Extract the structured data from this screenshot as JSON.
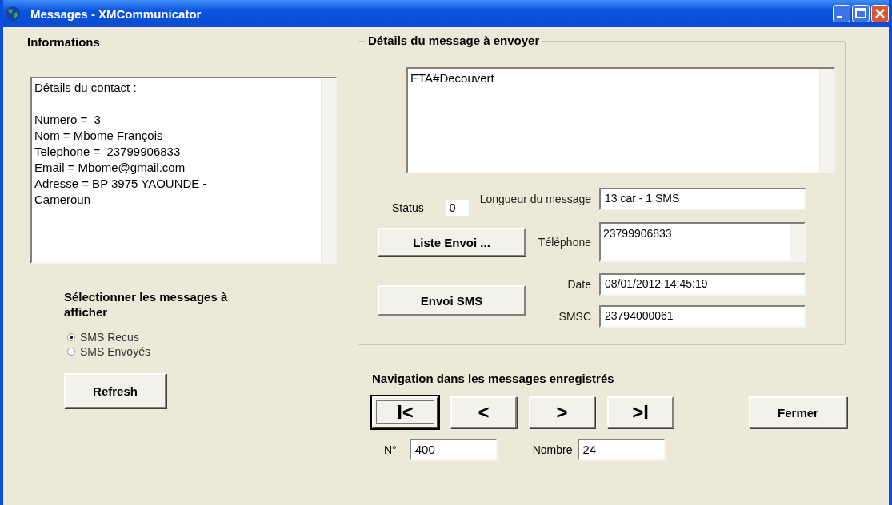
{
  "window": {
    "title": "Messages - XMCommunicator"
  },
  "informations": {
    "title": "Informations",
    "contact_heading": "Détails du contact :",
    "contact_lines": [
      "Numero =  3",
      "Nom = Mbome François",
      "Telephone =  23799906833",
      "Email = Mbome@gmail.com",
      "Adresse = BP 3975 YAOUNDE -",
      "Cameroun"
    ]
  },
  "filter": {
    "title": "Sélectionner les messages à afficher",
    "options": [
      {
        "label": "SMS Recus",
        "selected": true
      },
      {
        "label": "SMS Envoyés",
        "selected": false
      }
    ],
    "refresh_button": "Refresh"
  },
  "message": {
    "legend": "Détails du message à envoyer",
    "body": "ETA#Decouvert",
    "status_label": "Status",
    "status": "0",
    "length_label": "Longueur du message",
    "length": "13 car - 1 SMS",
    "list_button": "Liste Envoi ...",
    "phone_label": "Téléphone",
    "phone": "23799906833",
    "send_button": "Envoi SMS",
    "date_label": "Date",
    "date": "08/01/2012 14:45:19",
    "smsc_label": "SMSC",
    "smsc": "23794000061"
  },
  "navigation": {
    "title": "Navigation dans les messages enregistrés",
    "buttons": [
      {
        "label": "I<",
        "focused": true
      },
      {
        "label": "<",
        "focused": false
      },
      {
        "label": ">",
        "focused": false
      },
      {
        "label": ">I",
        "focused": false
      }
    ],
    "close_button": "Fermer",
    "number_label": "N°",
    "number": "400",
    "count_label": "Nombre",
    "count": "24"
  }
}
